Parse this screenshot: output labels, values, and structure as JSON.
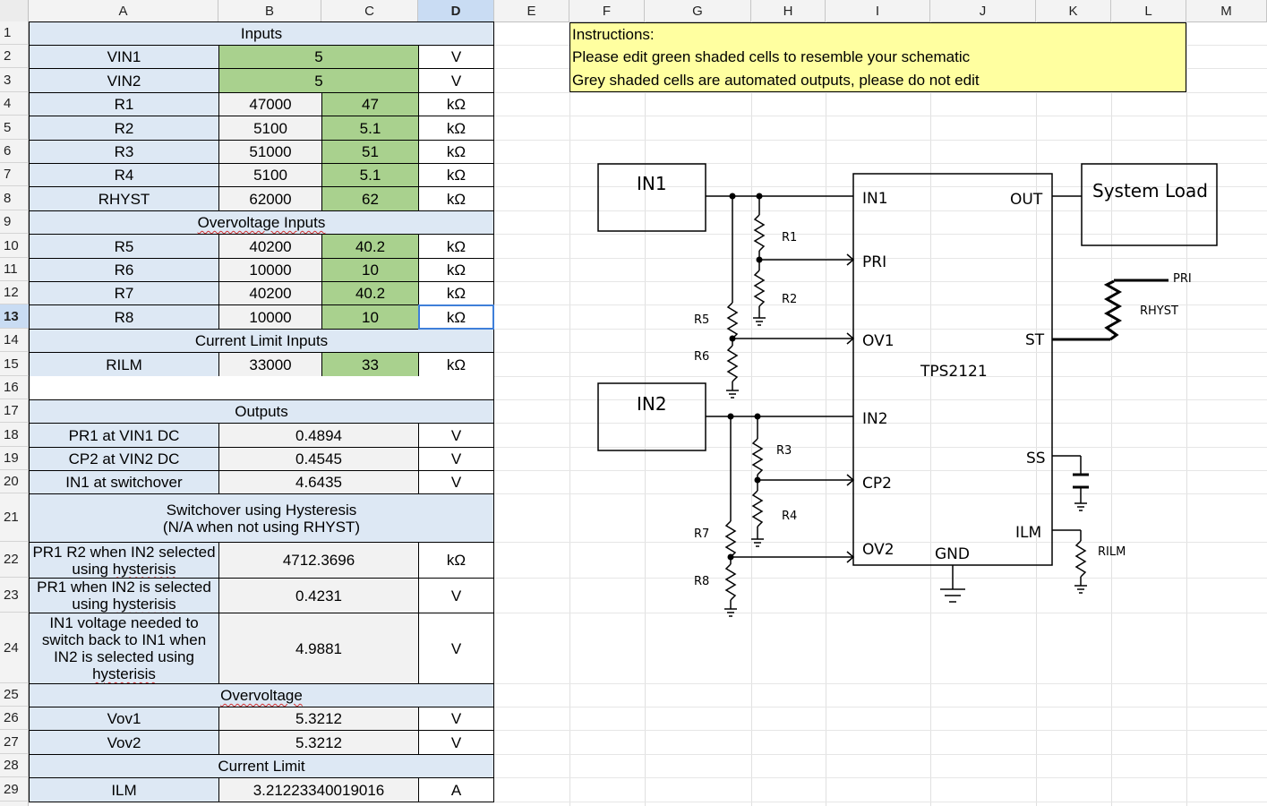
{
  "columns": [
    "A",
    "B",
    "C",
    "D",
    "E",
    "F",
    "G",
    "H",
    "I",
    "J",
    "K",
    "L",
    "M"
  ],
  "selected_column": "D",
  "selected_row": "13",
  "rows": [
    "1",
    "2",
    "3",
    "4",
    "5",
    "6",
    "7",
    "8",
    "9",
    "10",
    "11",
    "12",
    "13",
    "14",
    "15",
    "16",
    "17",
    "18",
    "19",
    "20",
    "21",
    "22",
    "23",
    "24",
    "25",
    "26",
    "27",
    "28",
    "29"
  ],
  "sheet": {
    "inputs_header": "Inputs",
    "vin1": {
      "label": "VIN1",
      "value": "5",
      "unit": "V"
    },
    "vin2": {
      "label": "VIN2",
      "value": "5",
      "unit": "V"
    },
    "r1": {
      "label": "R1",
      "ohms": "47000",
      "k": "47",
      "unit": "kΩ"
    },
    "r2": {
      "label": "R2",
      "ohms": "5100",
      "k": "5.1",
      "unit": "kΩ"
    },
    "r3": {
      "label": "R3",
      "ohms": "51000",
      "k": "51",
      "unit": "kΩ"
    },
    "r4": {
      "label": "R4",
      "ohms": "5100",
      "k": "5.1",
      "unit": "kΩ"
    },
    "rhyst": {
      "label": "RHYST",
      "ohms": "62000",
      "k": "62",
      "unit": "kΩ"
    },
    "ov_inputs_header": "Overvoltage Inputs",
    "r5": {
      "label": "R5",
      "ohms": "40200",
      "k": "40.2",
      "unit": "kΩ"
    },
    "r6": {
      "label": "R6",
      "ohms": "10000",
      "k": "10",
      "unit": "kΩ"
    },
    "r7": {
      "label": "R7",
      "ohms": "40200",
      "k": "40.2",
      "unit": "kΩ"
    },
    "r8": {
      "label": "R8",
      "ohms": "10000",
      "k": "10",
      "unit": "kΩ"
    },
    "cl_inputs_header": "Current Limit Inputs",
    "rilm": {
      "label": "RILM",
      "ohms": "33000",
      "k": "33",
      "unit": "kΩ"
    },
    "outputs_header": "Outputs",
    "pr1_vin1": {
      "label": "PR1 at VIN1 DC",
      "value": "0.4894",
      "unit": "V"
    },
    "cp2_vin2": {
      "label": "CP2 at VIN2 DC",
      "value": "0.4545",
      "unit": "V"
    },
    "in1_switch": {
      "label": "IN1 at switchover",
      "value": "4.6435",
      "unit": "V"
    },
    "hyst_header_1": "Switchover using Hysteresis",
    "hyst_header_2": "(N/A when not using RHYST)",
    "pr1r2": {
      "label_1": "PR1 R2 when IN2 selected",
      "label_2": "using ",
      "label_sq": "hysterisis",
      "value": "4712.3696",
      "unit": "kΩ"
    },
    "pr1in2": {
      "label_1": "PR1 when IN2 is selected",
      "label_2": "using ",
      "label_sq": "hysterisis",
      "value": "0.4231",
      "unit": "V"
    },
    "in1back": {
      "label_1": "IN1 voltage needed to",
      "label_2": "switch back to IN1 when",
      "label_3": "IN2 is selected using",
      "label_sq": "hysterisis",
      "value": "4.9881",
      "unit": "V"
    },
    "overvoltage_header": "Overvoltage",
    "vov1": {
      "label": "Vov1",
      "value": "5.3212",
      "unit": "V"
    },
    "vov2": {
      "label": "Vov2",
      "value": "5.3212",
      "unit": "V"
    },
    "current_limit_header": "Current Limit",
    "ilm": {
      "label": "ILM",
      "value": "3.21223340019016",
      "unit": "A"
    }
  },
  "instructions": {
    "line1": "Instructions:",
    "line2": "Please edit green shaded cells to resemble your schematic",
    "line3": "Grey shaded cells are automated outputs, please do not edit"
  },
  "schematic": {
    "in1_box": "IN1",
    "in2_box": "IN2",
    "load_box": "System Load",
    "chip": "TPS2121",
    "pins_left": [
      "IN1",
      "PRI",
      "OV1",
      "IN2",
      "CP2",
      "OV2"
    ],
    "pins_right": [
      "OUT",
      "ST",
      "SS",
      "ILM"
    ],
    "gnd": "GND",
    "resistors": [
      "R1",
      "R2",
      "R5",
      "R6",
      "R3",
      "R4",
      "R7",
      "R8",
      "RHYST",
      "RILM"
    ],
    "pri_label": "PRI"
  },
  "colors": {
    "green": "#a9d18e",
    "blue": "#dde8f4",
    "grey": "#f2f2f2",
    "yellow": "#ffffa0",
    "selection": "#3f7fd9"
  }
}
